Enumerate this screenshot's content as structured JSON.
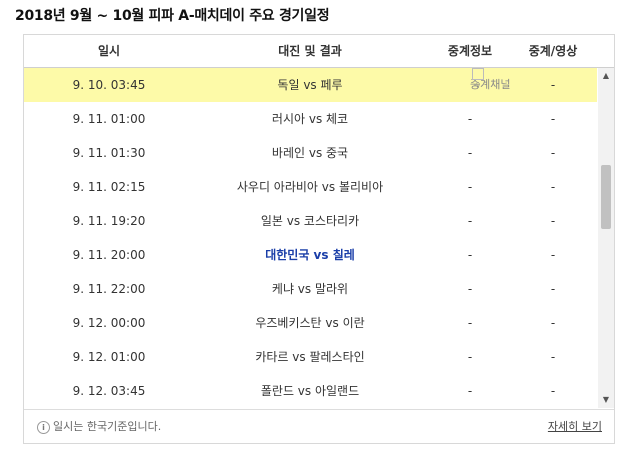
{
  "title": "2018년 9월 ~ 10월 피파 A-매치데이 주요 경기일정",
  "headers": {
    "date": "일시",
    "match": "대진 및 결과",
    "broadcast": "중계정보",
    "video": "중계/영상"
  },
  "rows": [
    {
      "date": "9. 10. 03:45",
      "match": "독일 vs 페루",
      "broadcast": "중계채널",
      "video": "-",
      "highlight": true
    },
    {
      "date": "9. 11. 01:00",
      "match": "러시아 vs 체코",
      "broadcast": "-",
      "video": "-"
    },
    {
      "date": "9. 11. 01:30",
      "match": "바레인 vs 중국",
      "broadcast": "-",
      "video": "-"
    },
    {
      "date": "9. 11. 02:15",
      "match": "사우디 아라비아 vs 볼리비아",
      "broadcast": "-",
      "video": "-"
    },
    {
      "date": "9. 11. 19:20",
      "match": "일본 vs 코스타리카",
      "broadcast": "-",
      "video": "-"
    },
    {
      "date": "9. 11. 20:00",
      "match": "대한민국 vs 칠레",
      "broadcast": "-",
      "video": "-",
      "korea": true
    },
    {
      "date": "9. 11. 22:00",
      "match": "케냐 vs 말라위",
      "broadcast": "-",
      "video": "-"
    },
    {
      "date": "9. 12. 00:00",
      "match": "우즈베키스탄 vs 이란",
      "broadcast": "-",
      "video": "-"
    },
    {
      "date": "9. 12. 01:00",
      "match": "카타르 vs 팔레스타인",
      "broadcast": "-",
      "video": "-"
    },
    {
      "date": "9. 12. 03:45",
      "match": "폴란드 vs 아일랜드",
      "broadcast": "-",
      "video": "-"
    }
  ],
  "footer": {
    "note": "일시는 한국기준입니다.",
    "more": "자세히 보기"
  },
  "colors": {
    "highlight": "#fdfaa8",
    "korea": "#1a3ea8"
  }
}
